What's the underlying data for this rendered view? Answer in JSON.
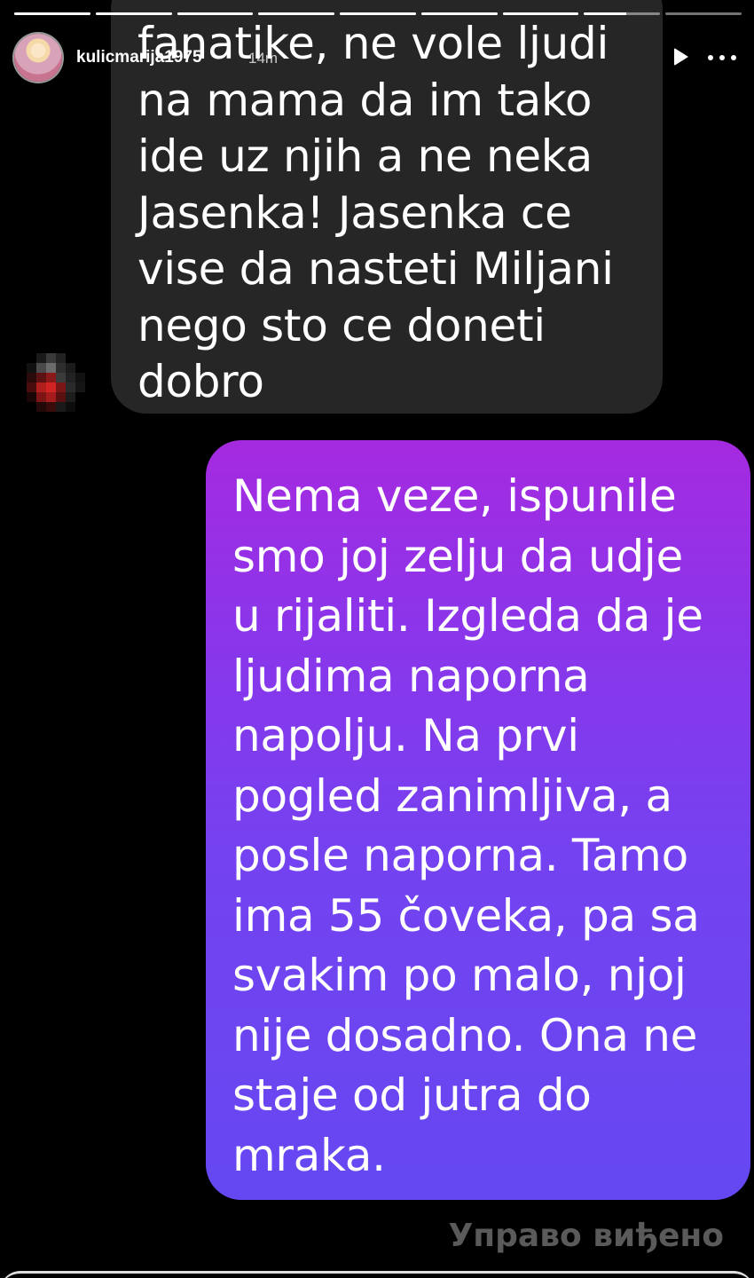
{
  "story": {
    "progress": [
      1,
      1,
      1,
      1,
      1,
      1,
      1,
      0.55,
      0
    ],
    "username": "kulicmarija1975",
    "time_ago": "14m",
    "icons": {
      "avatar": "profile-avatar",
      "play": "play-icon",
      "more": "more-options-icon"
    }
  },
  "chat": {
    "incoming_message": "fanatike, ne vole ljudi\nna mama da im tako\nide uz njih a ne neka\nJasenka! Jasenka ce\nvise da nasteti Miljani\nnego sto ce doneti\ndobro",
    "outgoing_message": "Nema veze, ispunile\nsmo joj zelju da udje\nu rijaliti. Izgleda da je\nljudima naporna\nnapolju. Na prvi\npogled zanimljiva, a\nposle naporna. Tamo\nima 55 čoveka, pa sa\nsvakim po malo, njoj\nnije dosadno. Ona ne\nstaje od jutra do\nmraka.",
    "seen_status": "Управо виђено"
  },
  "colors": {
    "background": "#000000",
    "incoming_bubble": "#262626",
    "outgoing_gradient_top": "#a52ae0",
    "outgoing_gradient_bottom": "#6548f2",
    "seen_text": "#5a5a5a"
  }
}
